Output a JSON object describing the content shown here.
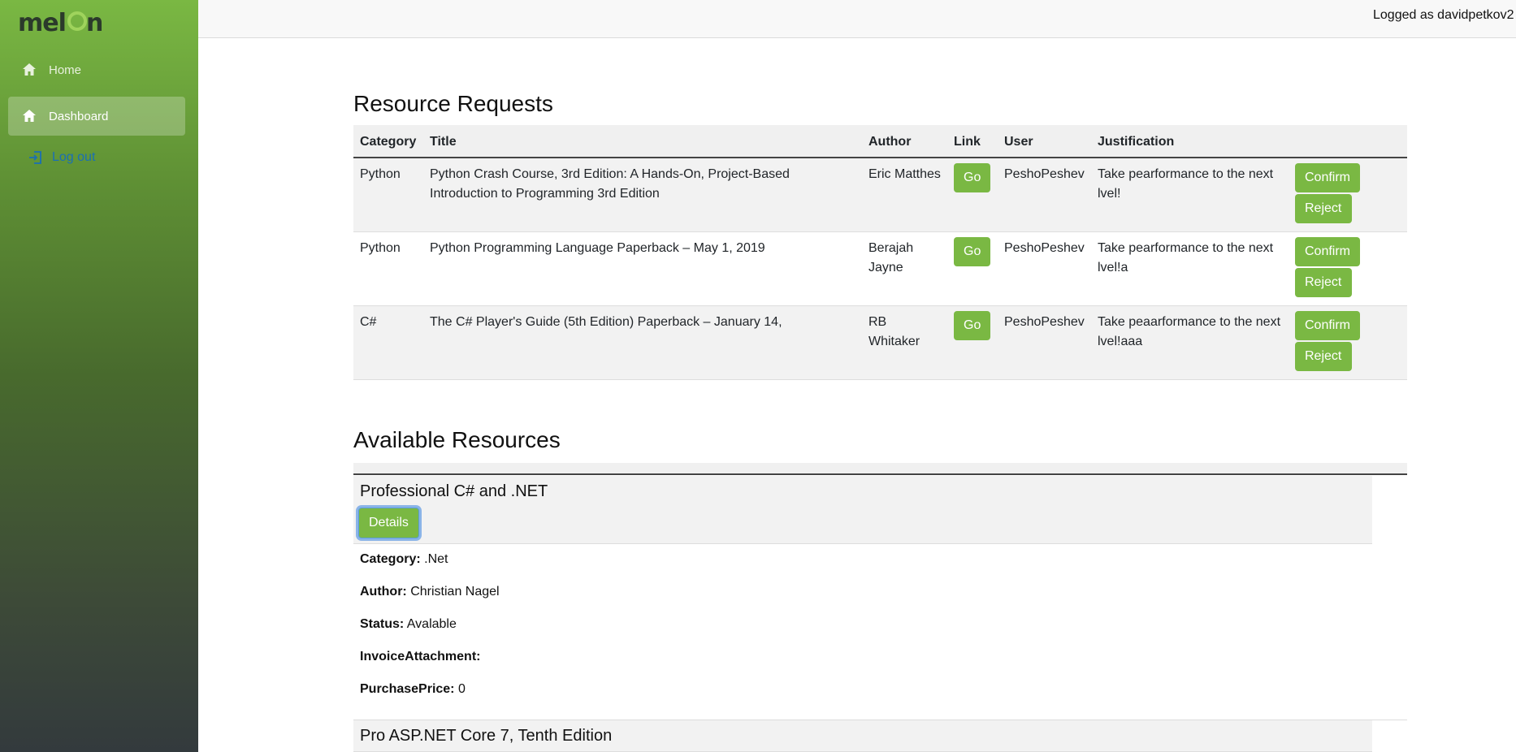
{
  "brand": {
    "logo_text": "mel n"
  },
  "sidebar": {
    "items": [
      {
        "label": "Home",
        "icon": "home-icon"
      },
      {
        "label": "Dashboard",
        "icon": "home-icon"
      }
    ],
    "logout_label": "Log out"
  },
  "topbar": {
    "logged_text": "Logged as davidpetkov2"
  },
  "requests": {
    "heading": "Resource Requests",
    "columns": [
      "Category",
      "Title",
      "Author",
      "Link",
      "User",
      "Justification"
    ],
    "rows": [
      {
        "category": "Python",
        "title": "Python Crash Course, 3rd Edition: A Hands-On, Project-Based Introduction to Programming 3rd Edition",
        "author": "Eric Matthes",
        "link_label": "Go",
        "user": "PeshoPeshev",
        "justification": "Take pearformance to the next lvel!",
        "confirm": "Confirm",
        "reject": "Reject"
      },
      {
        "category": "Python",
        "title": "Python Programming Language Paperback – May 1, 2019",
        "author": "Berajah Jayne",
        "link_label": "Go",
        "user": "PeshoPeshev",
        "justification": "Take pearformance to the next lvel!a",
        "confirm": "Confirm",
        "reject": "Reject"
      },
      {
        "category": "C#",
        "title": "The C# Player's Guide (5th Edition) Paperback – January 14,",
        "author": "RB Whitaker",
        "link_label": "Go",
        "user": "PeshoPeshev",
        "justification": "Take peaarformance to the next lvel!aaa",
        "confirm": "Confirm",
        "reject": "Reject"
      }
    ]
  },
  "available": {
    "heading": "Available Resources",
    "items": [
      {
        "title": "Professional C# and .NET",
        "details_label": "Details",
        "fields": {
          "category_label": "Category:",
          "category": ".Net",
          "author_label": "Author:",
          "author": "Christian Nagel",
          "status_label": "Status:",
          "status": "Avalable",
          "invoice_label": "InvoiceAttachment:",
          "invoice": "",
          "price_label": "PurchasePrice:",
          "price": "0"
        }
      },
      {
        "title": "Pro ASP.NET Core 7, Tenth Edition"
      }
    ]
  },
  "colors": {
    "accent": "#7ab843",
    "link": "#1a6fb5"
  }
}
